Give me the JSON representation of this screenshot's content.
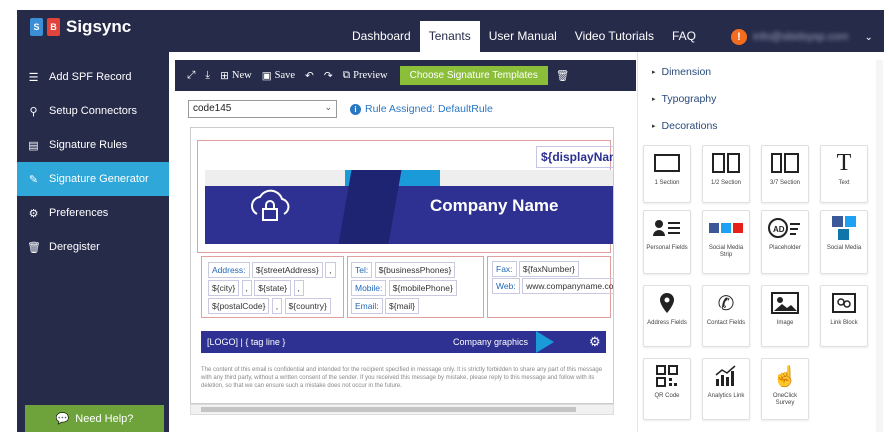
{
  "app": {
    "logo_s": "S",
    "logo_b": "B",
    "name": "Sigsync"
  },
  "nav": [
    {
      "label": "Dashboard",
      "active": false
    },
    {
      "label": "Tenants",
      "active": true
    },
    {
      "label": "User Manual",
      "active": false
    },
    {
      "label": "Video Tutorials",
      "active": false
    },
    {
      "label": "FAQ",
      "active": false
    }
  ],
  "user": {
    "alert": "!",
    "email": "info@sbidsysp.com"
  },
  "sidebar": {
    "items": [
      {
        "label": "Add SPF Record",
        "icon": "list-icon"
      },
      {
        "label": "Setup Connectors",
        "icon": "plug-icon"
      },
      {
        "label": "Signature Rules",
        "icon": "rules-icon"
      },
      {
        "label": "Signature Generator",
        "icon": "pencil-icon",
        "active": true
      },
      {
        "label": "Preferences",
        "icon": "gears-icon"
      },
      {
        "label": "Deregister",
        "icon": "trash-icon"
      }
    ],
    "help": "Need Help?"
  },
  "toolbar": {
    "new": "New",
    "save": "Save",
    "preview": "Preview",
    "templates": "Choose Signature Templates"
  },
  "template_select": {
    "value": "code145"
  },
  "rule_assigned": "Rule Assigned: DefaultRule",
  "signature": {
    "display_name": "${displayName}",
    "company": "Company Name",
    "address_label": "Address:",
    "street": "${streetAddress}",
    "city": "${city}",
    "state": "${state}",
    "postal": "${postalCode}",
    "country": "${country}",
    "comma": ",",
    "tel_label": "Tel:",
    "tel": "${businessPhones}",
    "mobile_label": "Mobile:",
    "mobile": "${mobilePhone}",
    "email_label": "Email:",
    "email": "${mail}",
    "fax_label": "Fax:",
    "fax": "${faxNumber}",
    "web_label": "Web:",
    "web": "www.companyname.com",
    "logo": "[LOGO]",
    "tagline": "{ tag line }",
    "graphics": "Company graphics",
    "disclaimer": "The content of this email is confidential and intended for the recipient specified in message only. It is strictly forbidden to share any part of this message with any third party, without a written consent of the sender. If you received this message by mistake, please reply to this message and follow with its deletion, so that we can ensure such a mistake does not occur in the future."
  },
  "panel": {
    "sections": [
      "Dimension",
      "Typography",
      "Decorations"
    ],
    "widgets": [
      {
        "label": "1 Section",
        "icon": "one-section-icon"
      },
      {
        "label": "1/2 Section",
        "icon": "half-section-icon"
      },
      {
        "label": "3/7 Section",
        "icon": "three-seven-section-icon"
      },
      {
        "label": "Text",
        "icon": "text-icon"
      },
      {
        "label": "Personal Fields",
        "icon": "personal-fields-icon"
      },
      {
        "label": "Social Media Strip",
        "icon": "social-strip-icon"
      },
      {
        "label": "Placeholder",
        "icon": "placeholder-icon"
      },
      {
        "label": "Social Media",
        "icon": "social-media-icon"
      },
      {
        "label": "Address Fields",
        "icon": "location-icon"
      },
      {
        "label": "Contact Fields",
        "icon": "phone-icon"
      },
      {
        "label": "Image",
        "icon": "image-icon"
      },
      {
        "label": "Link Block",
        "icon": "link-icon"
      },
      {
        "label": "QR Code",
        "icon": "qr-icon"
      },
      {
        "label": "Analytics Link",
        "icon": "analytics-icon"
      },
      {
        "label": "OneClick Survey",
        "icon": "click-icon"
      }
    ]
  },
  "colors": {
    "navy": "#262b4a",
    "active": "#2fa7d9",
    "green": "#8bbf3a",
    "brand": "#2e3192",
    "accent": "#1a9ad9"
  }
}
